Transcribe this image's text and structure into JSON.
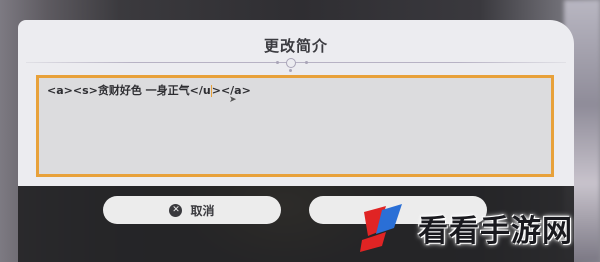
{
  "dialog": {
    "title": "更改简介",
    "bio_value": "<a><s>贪财好色 一身正气</u></a>",
    "bio_before_caret": "<a><s>贪财好色 一身正气</u",
    "bio_after_caret": "></a>"
  },
  "buttons": {
    "cancel_label": "取消",
    "cancel_icon": "x-circle-icon",
    "confirm_label": ""
  },
  "watermark": {
    "text": "看看手游网"
  },
  "colors": {
    "accent_border": "#e8a13a",
    "panel_bg": "#ececf0",
    "bottom_bar": "#242426"
  }
}
